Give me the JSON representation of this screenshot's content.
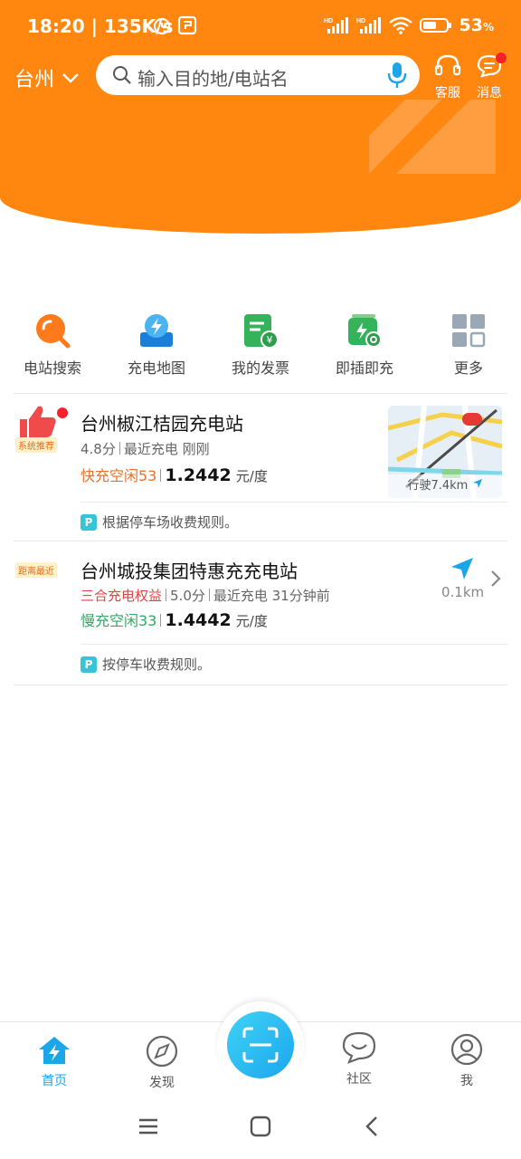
{
  "status_bar": {
    "time": "18:20",
    "net_speed": "135K/s",
    "battery": "53",
    "battery_unit": "%"
  },
  "header": {
    "city": "台州",
    "search_placeholder": "输入目的地/电站名",
    "service_label": "客服",
    "message_label": "消息"
  },
  "quick_actions": [
    {
      "label": "电站搜索",
      "icon": "search-station-icon"
    },
    {
      "label": "充电地图",
      "icon": "charge-map-icon"
    },
    {
      "label": "我的发票",
      "icon": "invoice-icon"
    },
    {
      "label": "即插即充",
      "icon": "plug-charge-icon"
    },
    {
      "label": "更多",
      "icon": "more-grid-icon"
    }
  ],
  "stations": [
    {
      "tag": "系统推荐",
      "name": "台州椒江桔园充电站",
      "rating": "4.8分",
      "last_charge": "最近充电 刚刚",
      "free": "快充空闲53",
      "price": "1.2442",
      "unit": "元/度",
      "distance": "行驶7.4km",
      "parking": "根据停车场收费规则。"
    },
    {
      "tag": "距离最近",
      "name": "台州城投集团特惠充充电站",
      "rights": "三合充电权益",
      "rating": "5.0分",
      "last_charge": "最近充电 31分钟前",
      "free": "慢充空闲33",
      "price": "1.4442",
      "unit": "元/度",
      "distance": "0.1km",
      "parking": "按停车收费规则。"
    }
  ],
  "bottom_nav": {
    "home": "首页",
    "discover": "发现",
    "community": "社区",
    "me": "我"
  },
  "colors": {
    "brand_orange": "#FF860F",
    "accent_blue": "#1AA6E8",
    "free_orange": "#E8712B",
    "free_green": "#35A666"
  }
}
